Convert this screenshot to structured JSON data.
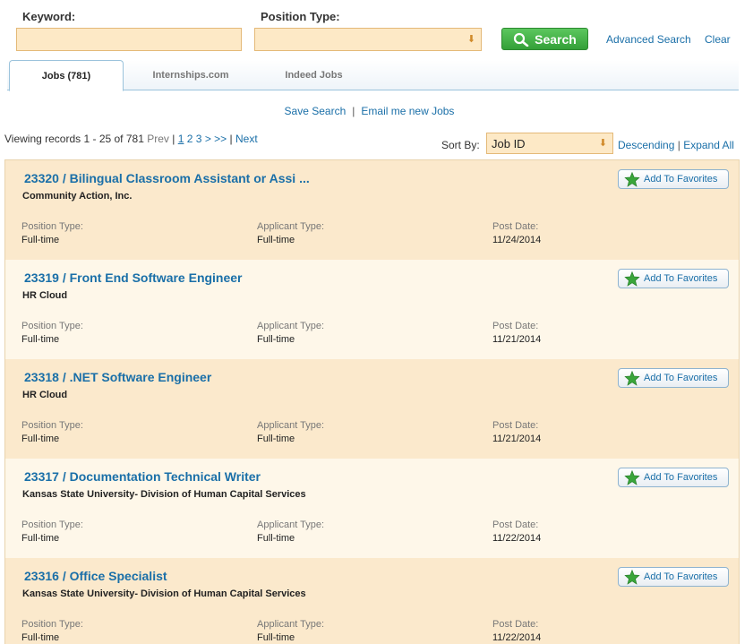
{
  "search": {
    "keyword_label": "Keyword:",
    "keyword_value": "",
    "position_type_label": "Position Type:",
    "position_type_value": "",
    "search_button": "Search",
    "advanced_search": "Advanced Search",
    "clear": "Clear"
  },
  "tabs": [
    {
      "label": "Jobs (781)",
      "active": true
    },
    {
      "label": "Internships.com",
      "active": false
    },
    {
      "label": "Indeed Jobs",
      "active": false
    }
  ],
  "actions": {
    "save_search": "Save Search",
    "separator": "|",
    "email_new_jobs": "Email me new Jobs"
  },
  "paging": {
    "viewing": "Viewing records 1 - 25 of 781",
    "prev": "Prev",
    "bar1": "|",
    "page1": "1",
    "page2": "2",
    "page3": "3",
    "next_arrow": ">",
    "last_arrow": ">>",
    "bar2": "|",
    "next": "Next"
  },
  "sort": {
    "label": "Sort By:",
    "value": "Job ID",
    "descending": "Descending",
    "separator": "|",
    "expand_all": "Expand All"
  },
  "fav_label": "Add To Favorites",
  "field_labels": {
    "position_type": "Position Type:",
    "applicant_type": "Applicant Type:",
    "post_date": "Post Date:"
  },
  "jobs": [
    {
      "title": "23320 / Bilingual Classroom Assistant or Assi ...",
      "company": "Community Action, Inc.",
      "position_type": "Full-time",
      "applicant_type": "Full-time",
      "post_date": "11/24/2014"
    },
    {
      "title": "23319 / Front End Software Engineer",
      "company": "HR Cloud",
      "position_type": "Full-time",
      "applicant_type": "Full-time",
      "post_date": "11/21/2014"
    },
    {
      "title": "23318 / .NET Software Engineer",
      "company": "HR Cloud",
      "position_type": "Full-time",
      "applicant_type": "Full-time",
      "post_date": "11/21/2014"
    },
    {
      "title": "23317 / Documentation Technical Writer",
      "company": "Kansas State University- Division of Human Capital Services",
      "position_type": "Full-time",
      "applicant_type": "Full-time",
      "post_date": "11/22/2014"
    },
    {
      "title": "23316 / Office Specialist",
      "company": "Kansas State University- Division of Human Capital Services",
      "position_type": "Full-time",
      "applicant_type": "Full-time",
      "post_date": "11/22/2014"
    }
  ]
}
